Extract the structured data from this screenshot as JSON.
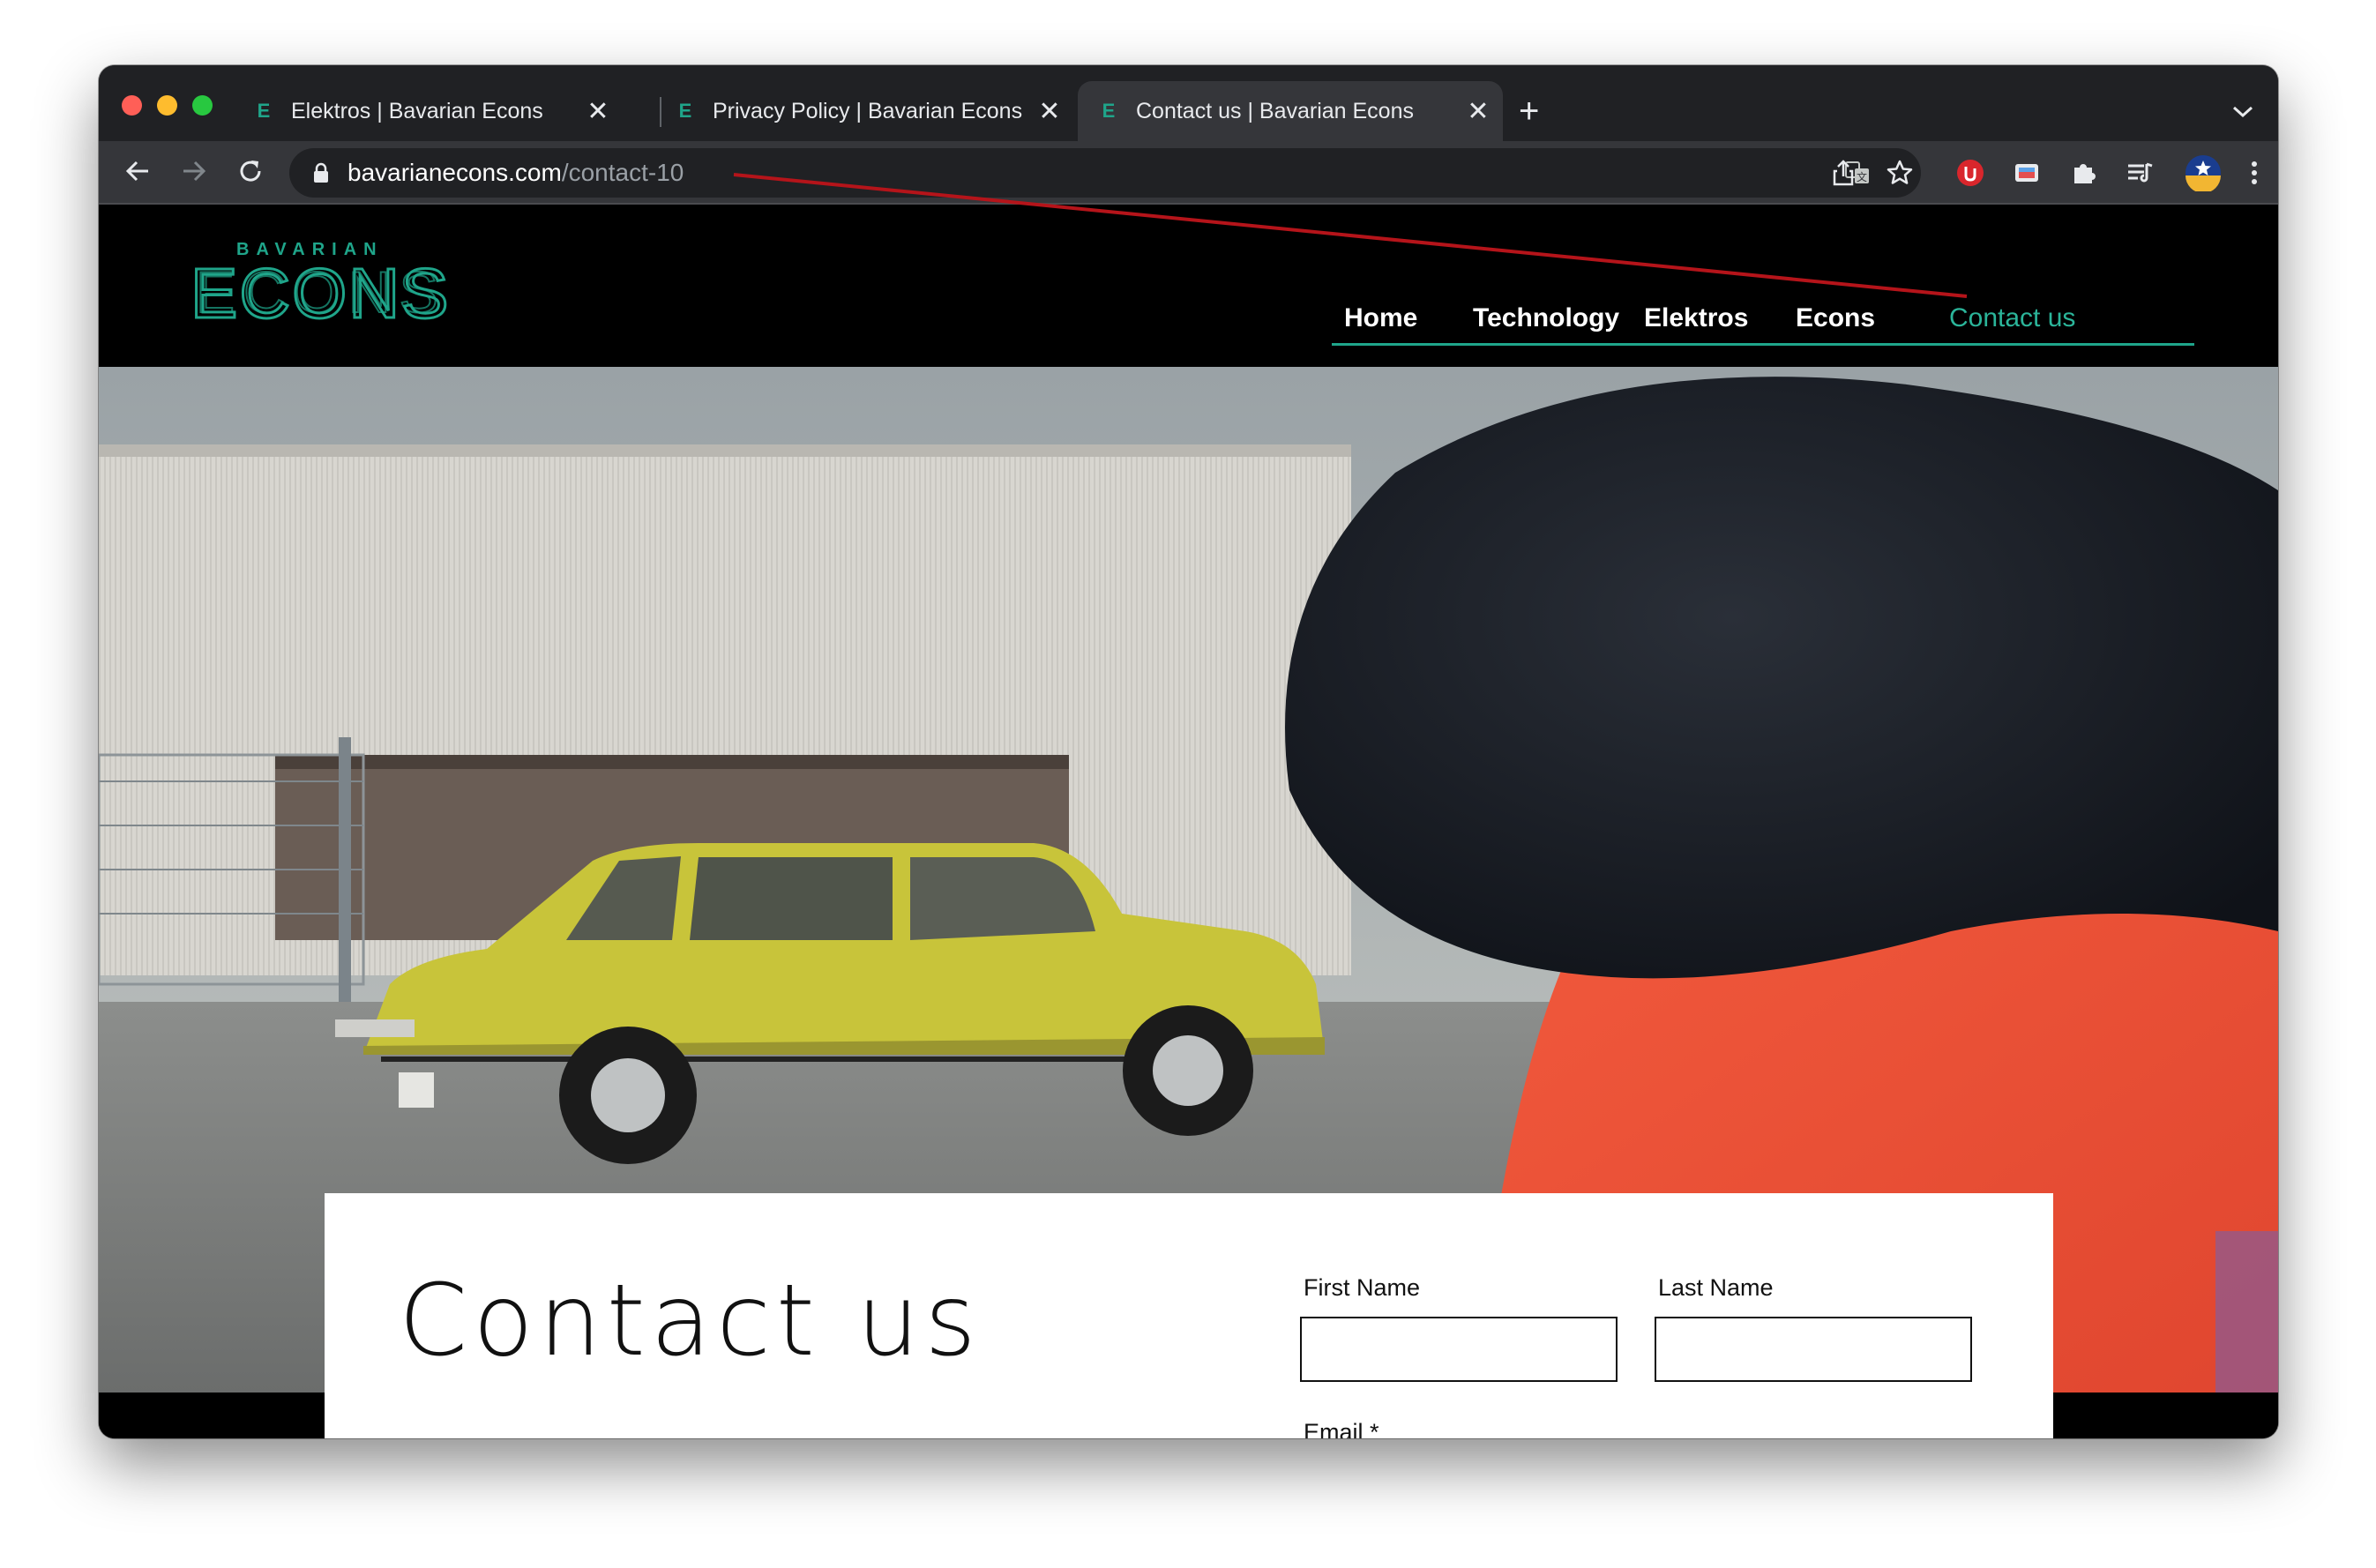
{
  "browser": {
    "tabs": [
      {
        "favicon": "E",
        "title": "Elektros | Bavarian Econs",
        "active": false
      },
      {
        "favicon": "E",
        "title": "Privacy Policy | Bavarian Econs",
        "active": false
      },
      {
        "favicon": "E",
        "title": "Contact us | Bavarian Econs",
        "active": true
      }
    ],
    "close_glyph": "✕",
    "newtab_glyph": "+",
    "tab_menu_glyph": "⌄",
    "url_host": "bavarianecons.com",
    "url_path": "/contact-10",
    "icons": [
      "back-icon",
      "forward-icon",
      "reload-icon",
      "lock-icon",
      "translate-icon",
      "share-icon",
      "bookmark-star-icon",
      "extension-red-icon",
      "extension-cast-icon",
      "puzzle-icon",
      "reading-list-icon",
      "profile-avatar-icon",
      "kebab-menu-icon"
    ]
  },
  "site": {
    "logo_top": "BAVARIAN",
    "logo_main": "ECONS",
    "nav": [
      "Home",
      "Technology",
      "Elektros",
      "Econs",
      "Contact us"
    ],
    "current_nav": "Contact us",
    "accent": "#1fa58a"
  },
  "contact": {
    "title": "Contact us",
    "first_name_label": "First Name",
    "last_name_label": "Last Name",
    "email_label": "Email *"
  },
  "annotation": {
    "color": "#b5141a"
  }
}
